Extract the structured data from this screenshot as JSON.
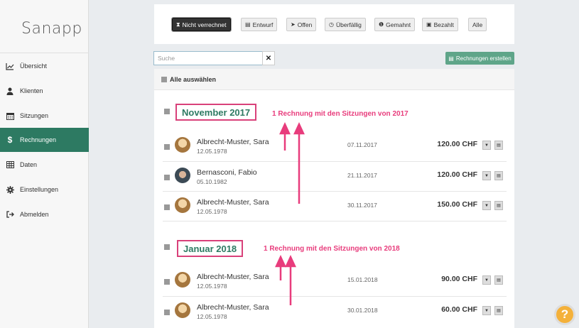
{
  "app": {
    "logo_text": "Sanapp"
  },
  "sidebar": {
    "items": [
      {
        "label": "Übersicht",
        "icon": "chart-line-icon"
      },
      {
        "label": "Klienten",
        "icon": "user-icon"
      },
      {
        "label": "Sitzungen",
        "icon": "calendar-icon"
      },
      {
        "label": "Rechnungen",
        "icon": "dollar-icon",
        "active": true
      },
      {
        "label": "Daten",
        "icon": "table-icon"
      },
      {
        "label": "Einstellungen",
        "icon": "gear-icon"
      },
      {
        "label": "Abmelden",
        "icon": "logout-icon"
      }
    ]
  },
  "filters": [
    {
      "label": "Nicht verrechnet",
      "icon": "hourglass-icon",
      "active": true
    },
    {
      "label": "Entwurf",
      "icon": "document-icon"
    },
    {
      "label": "Offen",
      "icon": "paper-plane-icon"
    },
    {
      "label": "Überfällig",
      "icon": "clock-icon"
    },
    {
      "label": "Gemahnt",
      "icon": "exclamation-icon"
    },
    {
      "label": "Bezahlt",
      "icon": "money-icon"
    },
    {
      "label": "Alle",
      "icon": ""
    }
  ],
  "search": {
    "placeholder": "Suche",
    "clear_label": "✕"
  },
  "create_button": {
    "label": "Rechnungen erstellen",
    "icon": "file-plus-icon"
  },
  "select_all_label": "Alle auswählen",
  "groups": [
    {
      "title": "November 2017",
      "annotation": "1 Rechnung mit den Sitzungen von 2017",
      "rows": [
        {
          "name": "Albrecht-Muster, Sara",
          "dob": "12.05.1978",
          "date": "07.11.2017",
          "amount": "120.00 CHF",
          "avatar": "female"
        },
        {
          "name": "Bernasconi, Fabio",
          "dob": "05.10.1982",
          "date": "21.11.2017",
          "amount": "120.00 CHF",
          "avatar": "male"
        },
        {
          "name": "Albrecht-Muster, Sara",
          "dob": "12.05.1978",
          "date": "30.11.2017",
          "amount": "150.00 CHF",
          "avatar": "female"
        }
      ]
    },
    {
      "title": "Januar 2018",
      "annotation": "1 Rechnung mit den Sitzungen von 2018",
      "rows": [
        {
          "name": "Albrecht-Muster, Sara",
          "dob": "12.05.1978",
          "date": "15.01.2018",
          "amount": "90.00 CHF",
          "avatar": "female"
        },
        {
          "name": "Albrecht-Muster, Sara",
          "dob": "12.05.1978",
          "date": "30.01.2018",
          "amount": "60.00 CHF",
          "avatar": "female"
        }
      ]
    }
  ],
  "help_label": "?",
  "colors": {
    "brand": "#2d7a62",
    "annotation": "#e83c7c",
    "help": "#f4b13a"
  }
}
